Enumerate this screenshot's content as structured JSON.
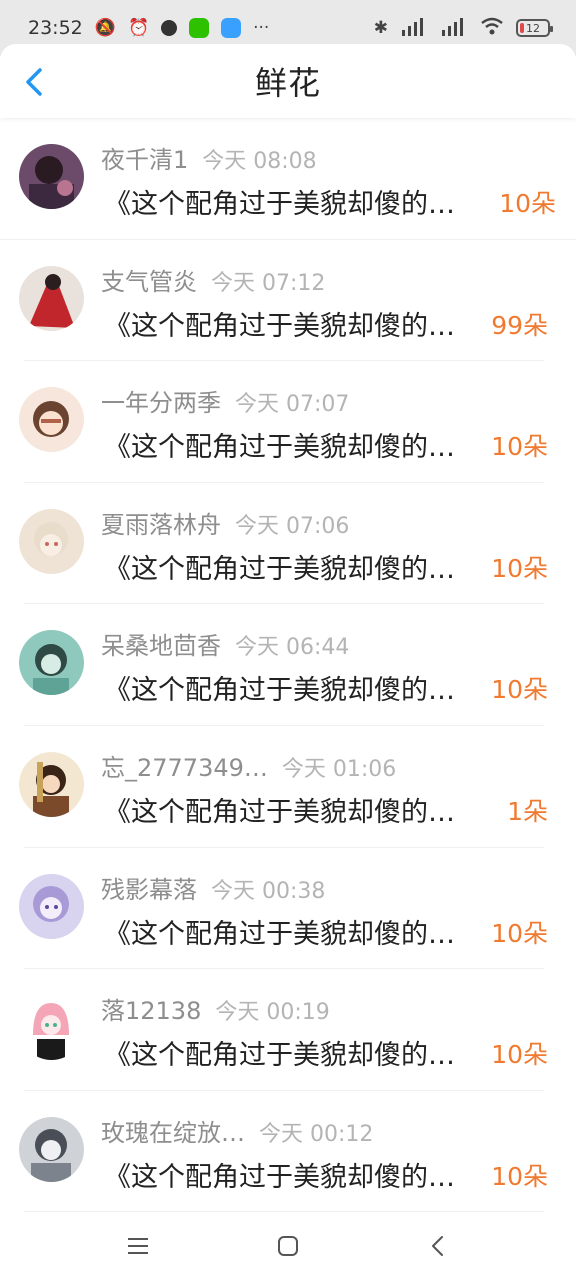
{
  "status": {
    "time": "23:52",
    "battery": "12",
    "icons": [
      "mute-icon",
      "alarm-icon",
      "app-icon",
      "wechat-icon",
      "message-icon",
      "more-dots-icon",
      "bluetooth-icon",
      "signal-hd-icon",
      "signal-hd-icon",
      "wifi-icon",
      "battery-icon"
    ]
  },
  "header": {
    "title": "鲜花",
    "back_icon": "chevron-left-icon"
  },
  "colors": {
    "accent_orange": "#f07a2f",
    "back_blue": "#2196f3"
  },
  "items": [
    {
      "name": "夜千清1",
      "time": "今天 08:08",
      "message": "《这个配角过于美貌却傻的…",
      "flowers": "10朵"
    },
    {
      "name": "支气管炎",
      "time": "今天 07:12",
      "message": "《这个配角过于美貌却傻的…",
      "flowers": "99朵"
    },
    {
      "name": "一年分两季",
      "time": "今天 07:07",
      "message": "《这个配角过于美貌却傻的…",
      "flowers": "10朵"
    },
    {
      "name": "夏雨落林舟",
      "time": "今天 07:06",
      "message": "《这个配角过于美貌却傻的…",
      "flowers": "10朵"
    },
    {
      "name": "呆桑地茴香",
      "time": "今天 06:44",
      "message": "《这个配角过于美貌却傻的…",
      "flowers": "10朵"
    },
    {
      "name": "忘_2777349…",
      "time": "今天 01:06",
      "message": "《这个配角过于美貌却傻的…",
      "flowers": "1朵"
    },
    {
      "name": "残影幕落",
      "time": "今天 00:38",
      "message": "《这个配角过于美貌却傻的…",
      "flowers": "10朵"
    },
    {
      "name": "落12138",
      "time": "今天 00:19",
      "message": "《这个配角过于美貌却傻的…",
      "flowers": "10朵"
    },
    {
      "name": "玫瑰在绽放…",
      "time": "今天 00:12",
      "message": "《这个配角过于美貌却傻的…",
      "flowers": "10朵"
    }
  ],
  "navbar": {
    "icons": [
      "menu-icon",
      "home-icon",
      "back-icon"
    ]
  }
}
